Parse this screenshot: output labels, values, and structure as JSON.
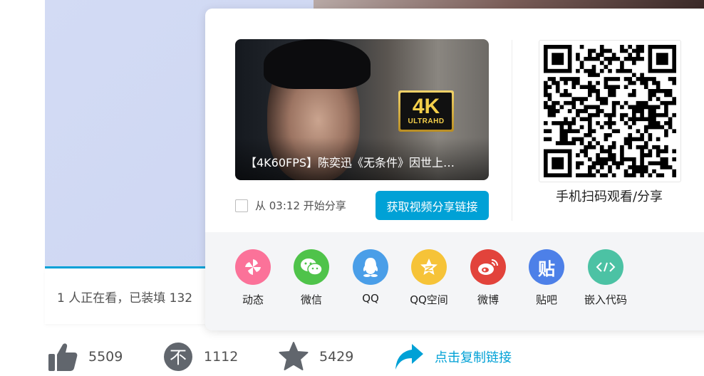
{
  "video": {
    "info_text": "1 人正在看，已装填 132"
  },
  "share_panel": {
    "thumbnail": {
      "title": "【4K60FPS】陈奕迅《无条件》因世上…",
      "badge_big": "4K",
      "badge_small": "ULTRAHD"
    },
    "start_share_label": "从 03:12 开始分享",
    "get_link_button": "获取视频分享链接",
    "qr_label": "手机扫码观看/分享",
    "share_targets": [
      {
        "label": "动态",
        "icon": "dynamic-icon",
        "color": "#fb7299"
      },
      {
        "label": "微信",
        "icon": "wechat-icon",
        "color": "#4fc34a"
      },
      {
        "label": "QQ",
        "icon": "qq-icon",
        "color": "#4a9ee8"
      },
      {
        "label": "QQ空间",
        "icon": "qzone-icon",
        "color": "#f6c338"
      },
      {
        "label": "微博",
        "icon": "weibo-icon",
        "color": "#e2433b"
      },
      {
        "label": "贴吧",
        "icon": "tieba-icon",
        "color": "#4d80e8"
      },
      {
        "label": "嵌入代码",
        "icon": "embed-code-icon",
        "color": "#4cc2a4"
      }
    ]
  },
  "actions": {
    "like_count": "5509",
    "coin_count": "1112",
    "favorite_count": "5429",
    "copy_link_label": "点击复制链接"
  },
  "colors": {
    "accent": "#00a1d6",
    "icon_gray": "#61666d"
  }
}
